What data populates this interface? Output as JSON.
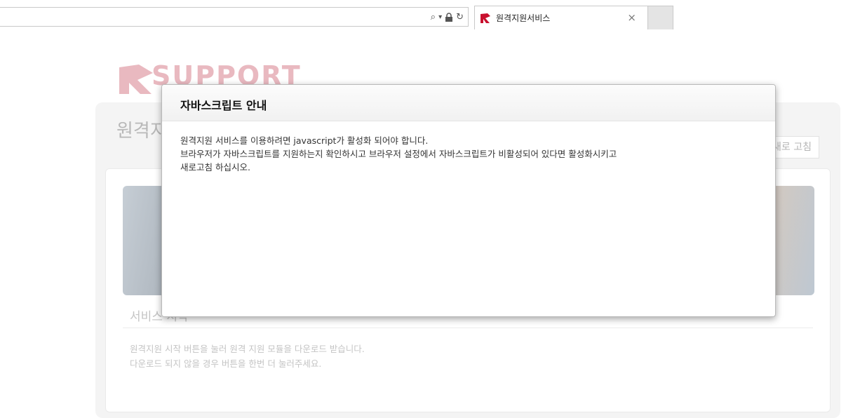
{
  "browser": {
    "tab_title": "원격지원서비스",
    "tab_close": "×",
    "address_icons": {
      "search": "⌕",
      "dropdown": "▾",
      "lock": "🔒",
      "refresh": "↻"
    }
  },
  "page": {
    "brand_text": "SUPPORT",
    "title": "원격지원 서비스",
    "refresh_button": "새로 고침",
    "service_label": "서비스 시작",
    "description_line1": "원격지원 시작 버튼을 눌러 원격 지원 모듈을 다운로드 받습니다.",
    "description_line2": "다운로드 되지 않을 경우 버튼을 한번 더 눌러주세요."
  },
  "modal": {
    "title": "자바스크립트 안내",
    "line1": "원격지원 서비스를 이용하려면 javascript가 활성화 되어야 합니다.",
    "line2": "브라우저가 자바스크립트를 지원하는지 확인하시고 브라우저 설정에서 자바스크립트가 비활성되어 있다면 활성화시키고",
    "line3": "새로고침 하십시오."
  },
  "colors": {
    "brand_red": "#c8102e",
    "brand_faded": "#e9b9c0"
  }
}
